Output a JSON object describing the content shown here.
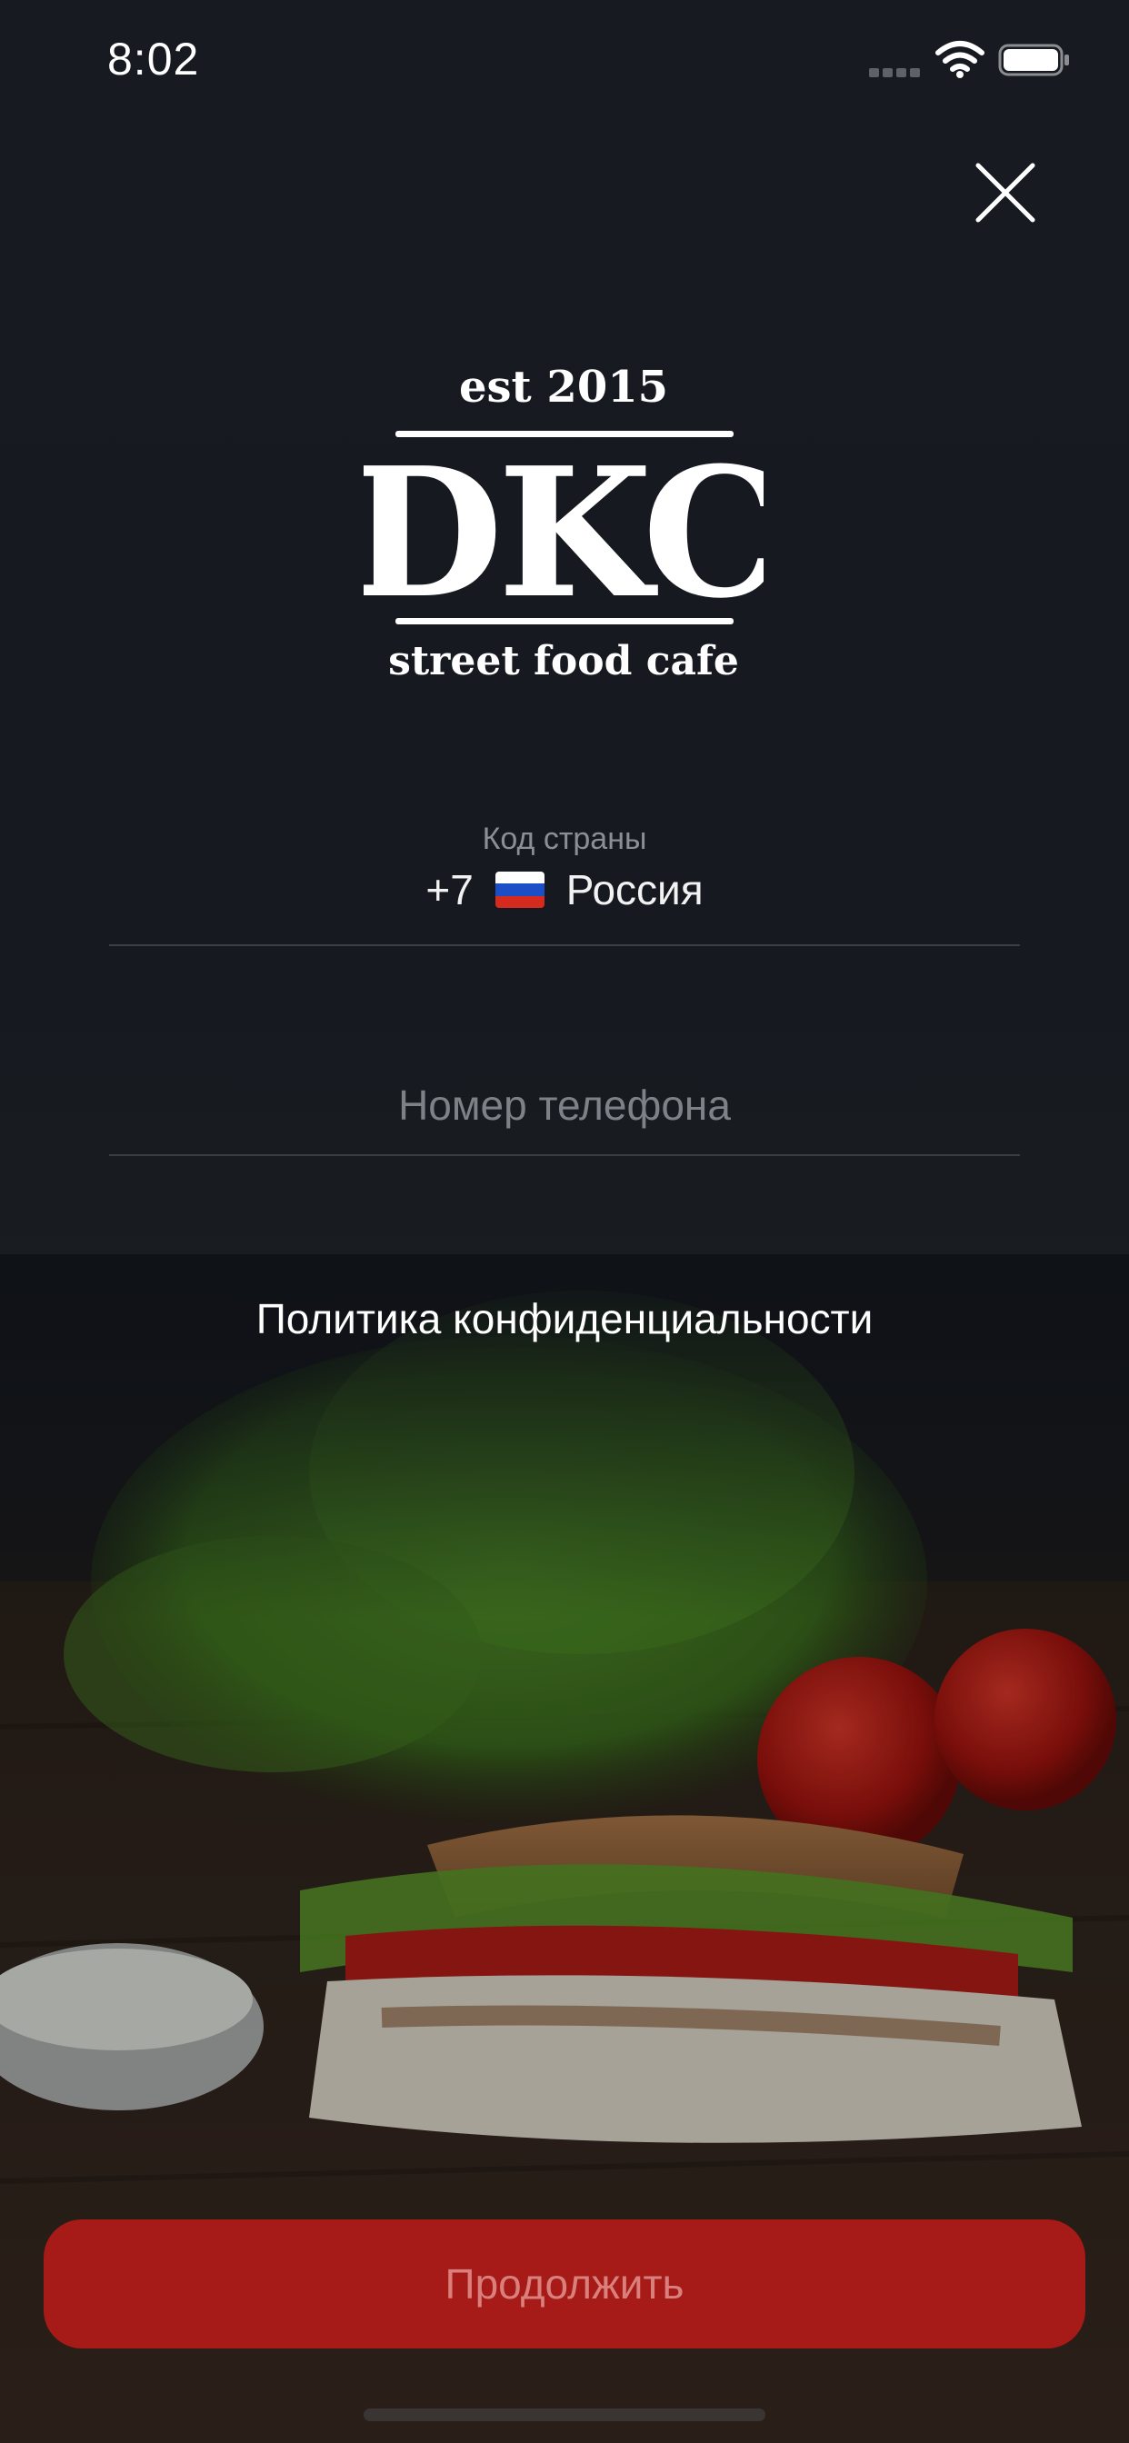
{
  "status_bar": {
    "time": "8:02"
  },
  "icons": {
    "close": "close-icon",
    "signal": "signal-icon",
    "wifi": "wifi-icon",
    "battery": "battery-icon",
    "flag": "russia-flag-icon"
  },
  "logo": {
    "established": "est 2015",
    "brand": "DKC",
    "tagline": "street food cafe"
  },
  "form": {
    "country_code_label": "Код страны",
    "country_code": "+7",
    "country_name": "Россия",
    "phone_placeholder": "Номер телефона",
    "phone_value": ""
  },
  "privacy_link": "Политика конфиденциальности",
  "continue_button": "Продолжить",
  "colors": {
    "background": "#161a20",
    "button": "#a61a17",
    "button_text": "#d9807c",
    "divider": "#3a3f46"
  }
}
